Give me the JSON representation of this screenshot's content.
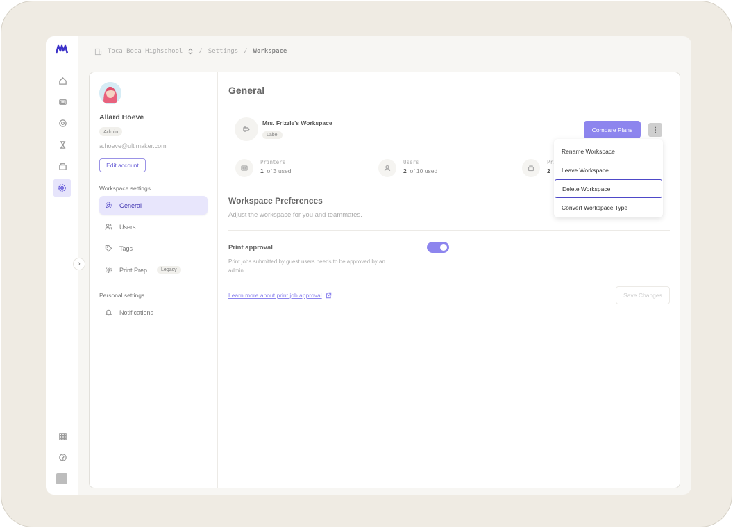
{
  "breadcrumb": {
    "organization": "Toca Boca Highschool",
    "separator": "/",
    "section": "Settings",
    "current": "Workspace"
  },
  "profile": {
    "name": "Allard Hoeve",
    "role": "Admin",
    "email": "a.hoeve@ultimaker.com",
    "edit_label": "Edit account"
  },
  "sidebar": {
    "workspace_settings_title": "Workspace settings",
    "items": [
      {
        "label": "General",
        "icon": "gear-icon",
        "active": true
      },
      {
        "label": "Users",
        "icon": "users-icon"
      },
      {
        "label": "Tags",
        "icon": "tag-icon"
      },
      {
        "label": "Print Prep",
        "icon": "gear-icon",
        "badge": "Legacy"
      }
    ],
    "personal_settings_title": "Personal settings",
    "personal_items": [
      {
        "label": "Notifications",
        "icon": "bell-icon"
      }
    ]
  },
  "main": {
    "title": "General",
    "workspace": {
      "name": "Mrs. Frizzle's Workspace",
      "label": "Label",
      "compare_label": "Compare Plans",
      "more_label": "⋮"
    },
    "stats": [
      {
        "label": "Printers",
        "value": "1",
        "suffix": "of 3 used"
      },
      {
        "label": "Users",
        "value": "2",
        "suffix": "of 10 used"
      },
      {
        "label": "Pri",
        "value": "2",
        "suffix": ""
      }
    ],
    "preferences": {
      "title": "Workspace Preferences",
      "subtitle": "Adjust the workspace for you and teammates.",
      "print_approval_title": "Print approval",
      "print_approval_desc": "Print jobs submitted by guest users needs to be approved by an admin.",
      "print_approval_enabled": true,
      "learn_more": "Learn more about print job approval",
      "save_label": "Save Changes"
    }
  },
  "dropdown": {
    "items": [
      "Rename Workspace",
      "Leave Workspace",
      "Delete Workspace",
      "Convert Workspace Type"
    ],
    "selected_index": 2
  },
  "colors": {
    "accent": "#8d85ee",
    "active_nav_bg": "#e8e6fc",
    "brand": "#3d33c9"
  },
  "rail": {
    "icons": [
      "home-icon",
      "printer-icon",
      "material-icon",
      "queue-icon",
      "box-icon",
      "settings-icon",
      "apps-grid-icon",
      "help-icon",
      "user-avatar"
    ]
  }
}
